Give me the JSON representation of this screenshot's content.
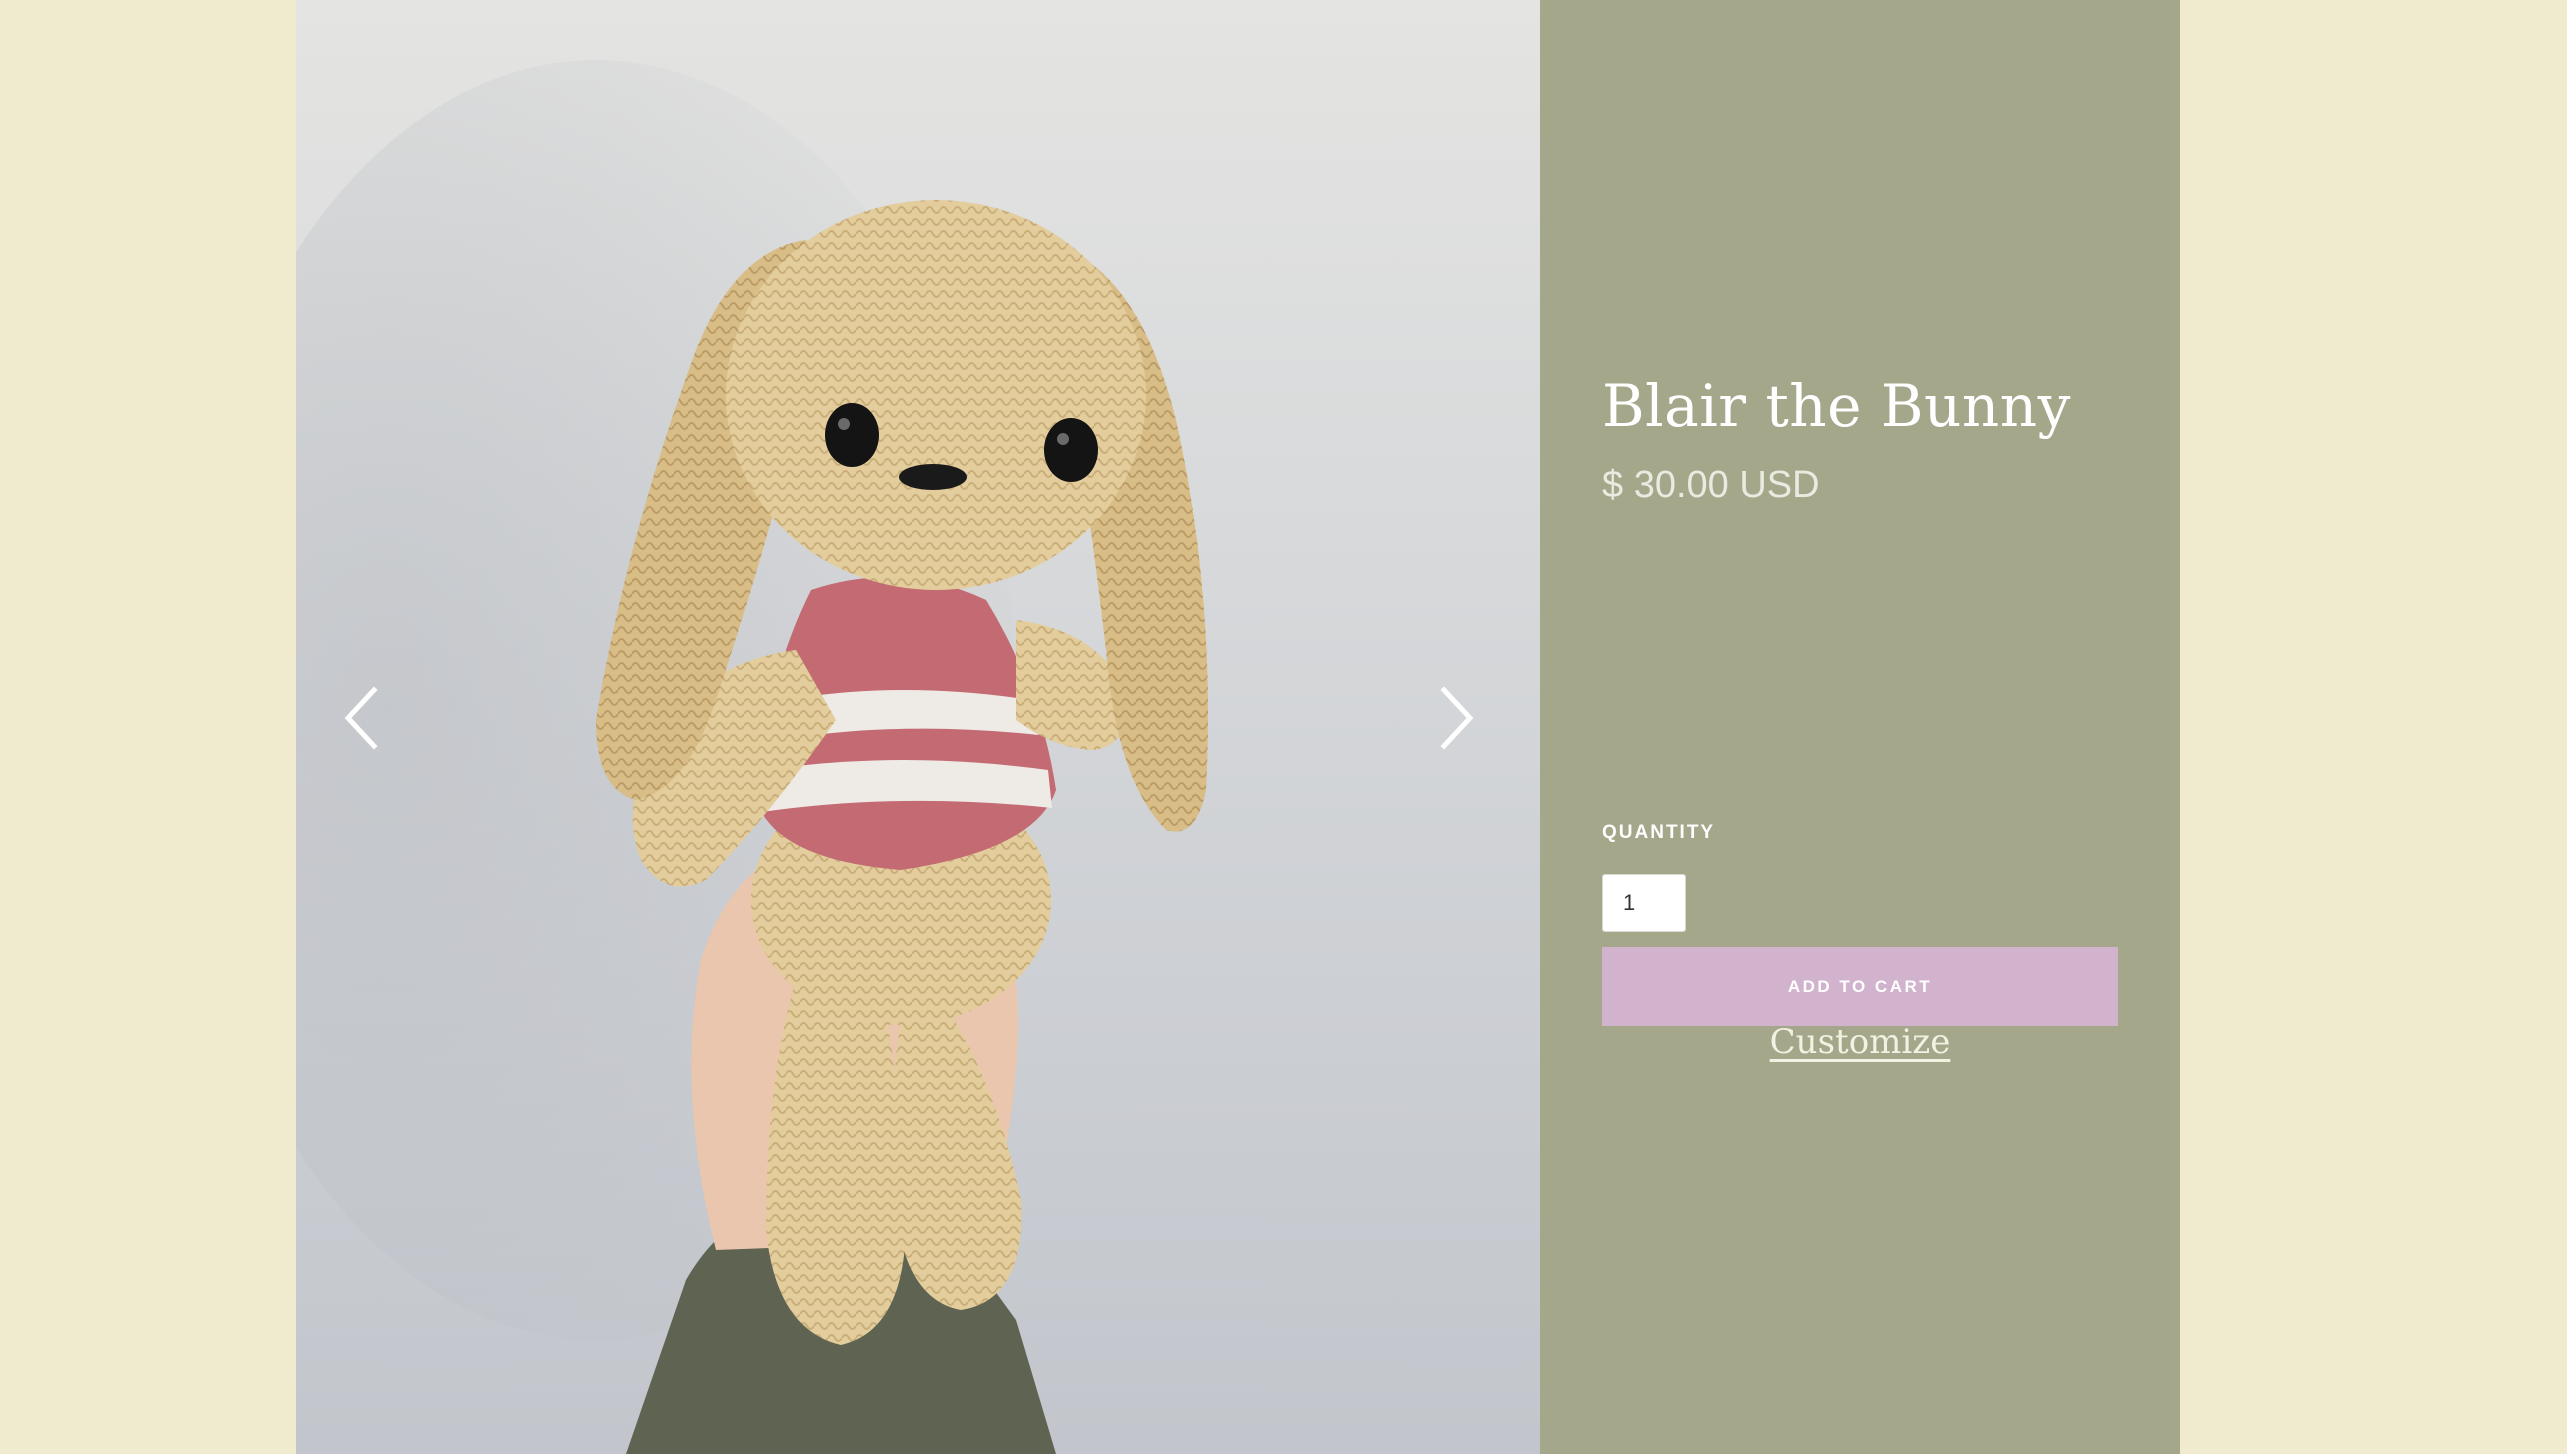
{
  "gallery": {
    "image_alt": "Crocheted bunny plush held in hand",
    "prev_icon": "chevron-left-icon",
    "next_icon": "chevron-right-icon"
  },
  "product": {
    "title": "Blair the Bunny",
    "price": "$ 30.00 USD",
    "quantity_label": "QUANTITY",
    "quantity_value": "1",
    "add_to_cart_label": "ADD TO CART",
    "customize_label": "Customize"
  },
  "colors": {
    "page_background": "#f0ebce",
    "info_panel": "#a5a78b",
    "add_to_cart_button": "#d1b3cd"
  }
}
